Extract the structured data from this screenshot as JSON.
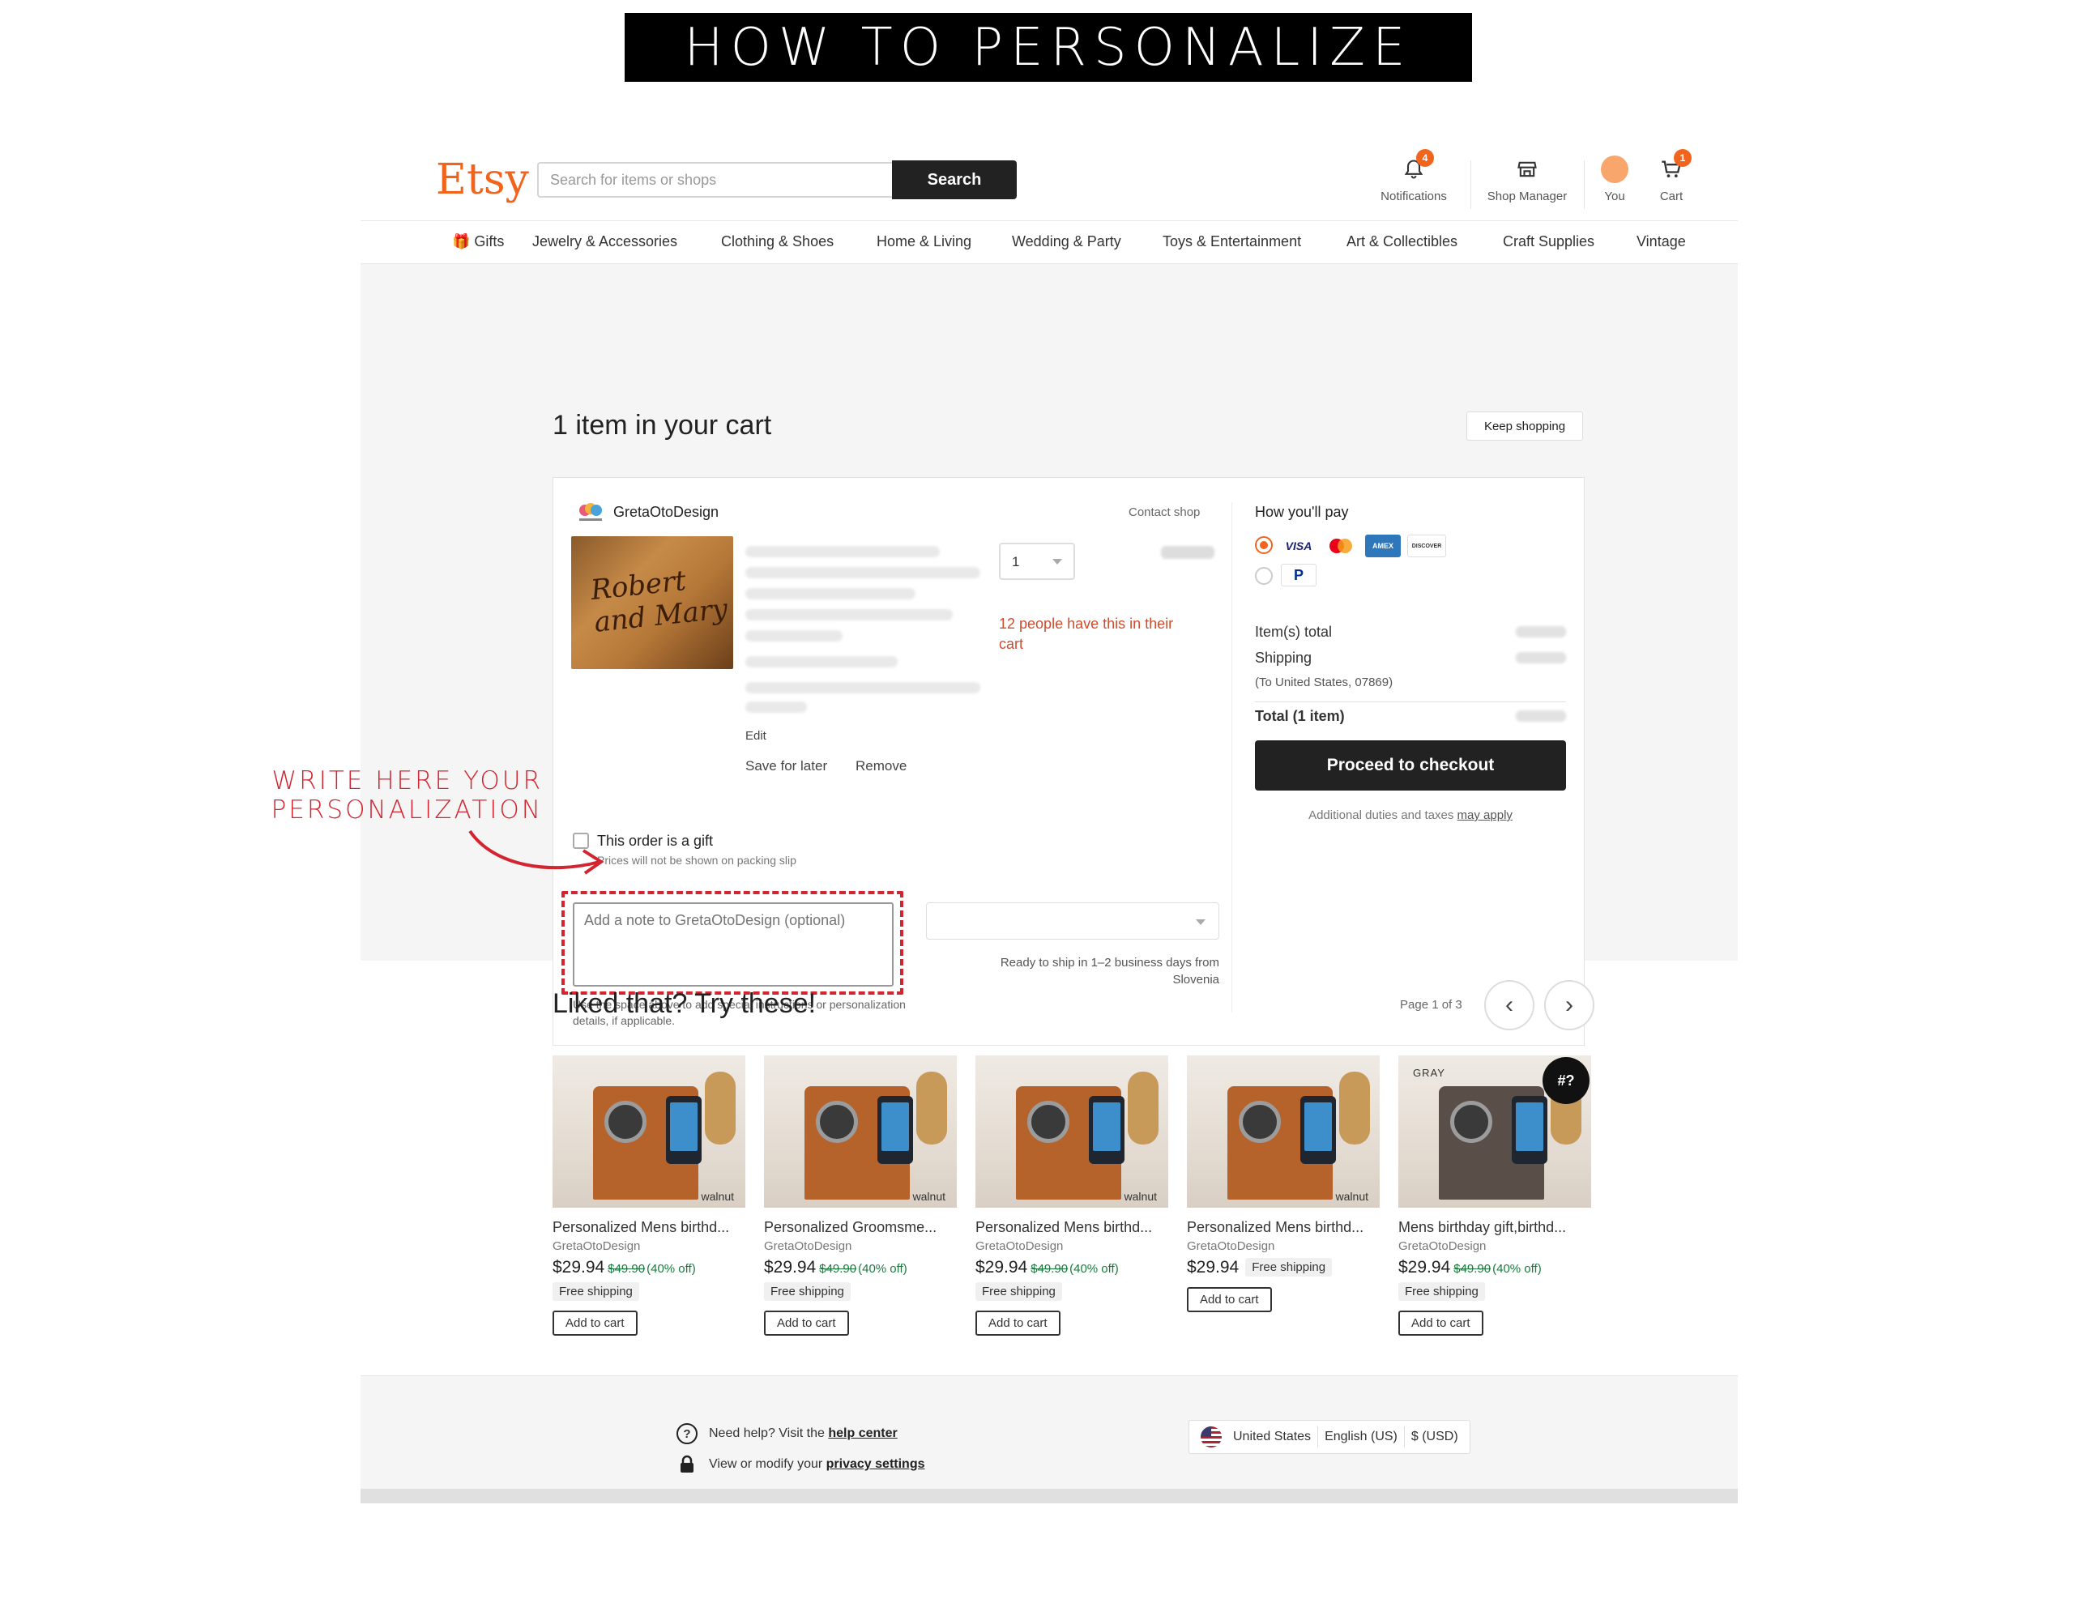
{
  "banner": {
    "title": "HOW TO PERSONALIZE"
  },
  "annotation": {
    "text_line1": "WRITE HERE YOUR",
    "text_line2": "PERSONALIZATION",
    "color": "#d32530"
  },
  "header": {
    "logo": "Etsy",
    "search": {
      "placeholder": "Search for items or shops",
      "button": "Search"
    },
    "items": [
      {
        "label": "Notifications",
        "icon": "bell-icon",
        "badge": "4"
      },
      {
        "label": "Shop Manager",
        "icon": "shop-icon"
      },
      {
        "label": "You",
        "icon": "avatar"
      },
      {
        "label": "Cart",
        "icon": "cart-icon",
        "badge": "1"
      }
    ],
    "accent_color": "#f1641e"
  },
  "nav": {
    "items": [
      "Gifts",
      "Jewelry & Accessories",
      "Clothing & Shoes",
      "Home & Living",
      "Wedding & Party",
      "Toys & Entertainment",
      "Art & Collectibles",
      "Craft Supplies",
      "Vintage"
    ]
  },
  "cart": {
    "title": "1 item in your cart",
    "keep_shopping": "Keep shopping",
    "shop_name": "GretaOtoDesign",
    "contact_shop": "Contact shop",
    "product_image_text": "Robert and Mary",
    "edit": "Edit",
    "save_for_later": "Save for later",
    "remove": "Remove",
    "quantity": "1",
    "people_note": "12 people have this in their cart",
    "gift_label": "This order is a gift",
    "gift_sub": "Prices will not be shown on packing slip",
    "note_placeholder": "Add a note to GretaOtoDesign (optional)",
    "note_help": "Use the space above to add special instructions or personalization details, if applicable.",
    "ship_note": "Ready to ship in 1–2 business days from Slovenia"
  },
  "payment": {
    "title": "How you'll pay",
    "methods": [
      "VISA",
      "Mastercard",
      "AMEX",
      "DISCOVER",
      "PayPal"
    ],
    "items_total": "Item(s) total",
    "shipping": "Shipping",
    "shipping_dest": "(To United States, 07869)",
    "total": "Total (1 item)",
    "checkout": "Proceed to checkout",
    "duties": "Additional duties and taxes",
    "duties_link": "may apply"
  },
  "recommendations": {
    "title": "Liked that? Try these!",
    "page": "Page 1 of 3",
    "items": [
      {
        "title": "Personalized Mens birthd...",
        "shop": "GretaOtoDesign",
        "price": "$29.94",
        "old": "$49.90",
        "off": "(40% off)",
        "shipping": "Free shipping",
        "button": "Add to cart",
        "tag": "walnut"
      },
      {
        "title": "Personalized Groomsme...",
        "shop": "GretaOtoDesign",
        "price": "$29.94",
        "old": "$49.90",
        "off": "(40% off)",
        "shipping": "Free shipping",
        "button": "Add to cart",
        "tag": "walnut"
      },
      {
        "title": "Personalized Mens birthd...",
        "shop": "GretaOtoDesign",
        "price": "$29.94",
        "old": "$49.90",
        "off": "(40% off)",
        "shipping": "Free shipping",
        "button": "Add to cart",
        "tag": "walnut"
      },
      {
        "title": "Personalized Mens birthd...",
        "shop": "GretaOtoDesign",
        "price": "$29.94",
        "shipping": "Free shipping",
        "button": "Add to cart",
        "tag": "walnut"
      },
      {
        "title": "Mens birthday gift,birthd...",
        "shop": "GretaOtoDesign",
        "price": "$29.94",
        "old": "$49.90",
        "off": "(40% off)",
        "shipping": "Free shipping",
        "button": "Add to cart",
        "tag": "GRAY"
      }
    ]
  },
  "footer": {
    "help_text": "Need help? Visit the",
    "help_link": "help center",
    "privacy_text": "View or modify your",
    "privacy_link": "privacy settings",
    "region": "United States",
    "language": "English (US)",
    "currency": "$ (USD)"
  }
}
